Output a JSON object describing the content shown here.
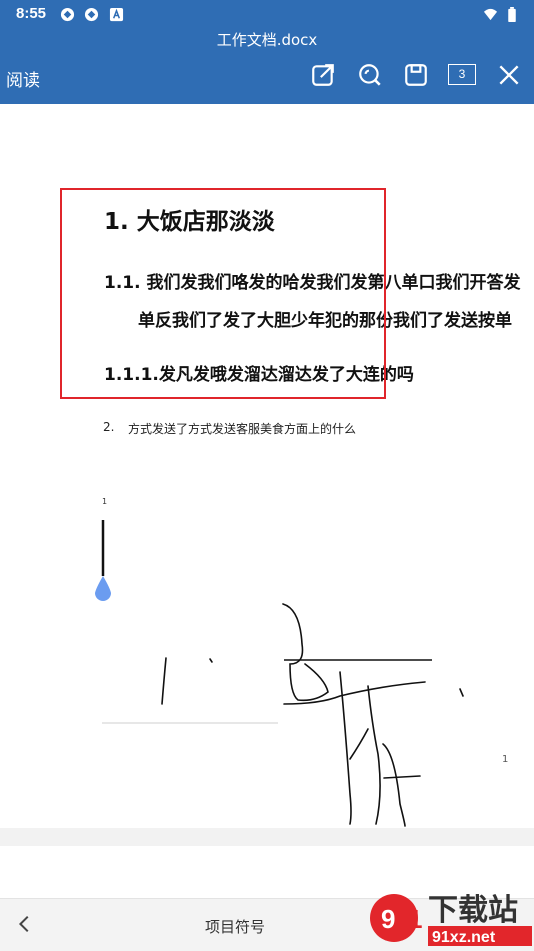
{
  "status_bar": {
    "time": "8:55",
    "left_icons": [
      "sync-icon",
      "sync-icon",
      "a-box-icon"
    ],
    "right_icons": [
      "wifi-icon",
      "battery-icon"
    ]
  },
  "header": {
    "doc_title": "工作文档.docx",
    "mode_label": "阅读",
    "tools": [
      "open-external-icon",
      "search-icon",
      "save-icon",
      "page-count-icon",
      "close-icon"
    ],
    "page_count": "3"
  },
  "document": {
    "heading1": "1. 大饭店那淡淡",
    "heading2_line1": "1.1. 我们发我们咯发的哈发我们发第八单口我们开答发",
    "heading2_line2": "单反我们了发了大胆少年犯的那份我们了发送按单",
    "heading3": "1.1.1.发凡发哦发溜达溜达发了大连的吗",
    "list_number": "2.",
    "list_text": "方式发送了方式发送客服美食方面上的什么",
    "tiny_label_1": "1",
    "tiny_label_2": "1"
  },
  "colors": {
    "header_bg": "#2f6db4",
    "selection_border": "#e0252b",
    "cursor_handle": "#6b9cf0"
  },
  "bottom_bar": {
    "label": "项目符号"
  },
  "watermark": {
    "text": "下载站",
    "url_text": "91xz.net"
  }
}
